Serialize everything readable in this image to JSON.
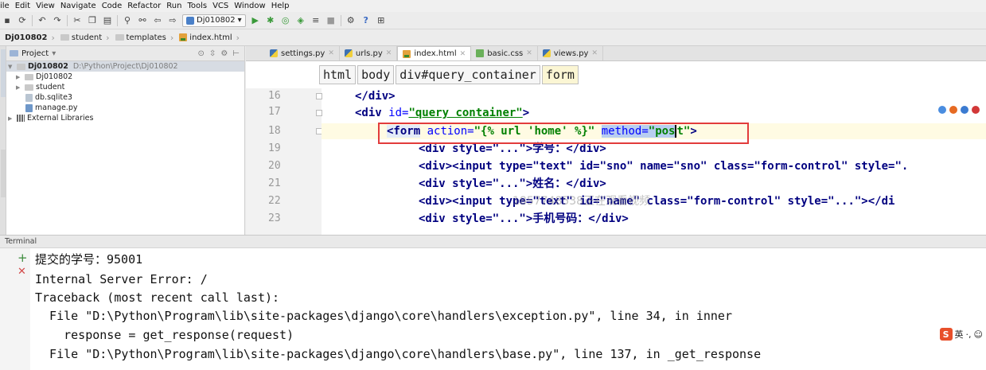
{
  "menu": [
    {
      "label": "ile",
      "u": ""
    },
    {
      "label": "Edit",
      "u": "E"
    },
    {
      "label": "View",
      "u": "V"
    },
    {
      "label": "Navigate",
      "u": "N"
    },
    {
      "label": "Code",
      "u": "C"
    },
    {
      "label": "Refactor",
      "u": "R"
    },
    {
      "label": "Run",
      "u": "u"
    },
    {
      "label": "Tools",
      "u": "T"
    },
    {
      "label": "VCS",
      "u": "S"
    },
    {
      "label": "Window",
      "u": "W"
    },
    {
      "label": "Help",
      "u": "H"
    }
  ],
  "toolbar": {
    "run_config": "Dj010802"
  },
  "breadcrumb": [
    "Dj010802",
    "student",
    "templates",
    "index.html"
  ],
  "project_panel": {
    "title": "Project",
    "root_name": "Dj010802",
    "root_path": "D:\\Python\\Project\\Dj010802",
    "items": [
      "Dj010802",
      "student",
      "db.sqlite3",
      "manage.py",
      "External Libraries"
    ]
  },
  "editor_tabs": [
    {
      "label": "settings.py",
      "type": "py"
    },
    {
      "label": "urls.py",
      "type": "py"
    },
    {
      "label": "index.html",
      "type": "html",
      "active": true
    },
    {
      "label": "basic.css",
      "type": "css"
    },
    {
      "label": "views.py",
      "type": "py"
    }
  ],
  "editor": {
    "path": [
      "html",
      "body",
      "div#query_container",
      "form"
    ],
    "line_numbers": [
      "16",
      "17",
      "18",
      "19",
      "20",
      "21",
      "22",
      "23"
    ],
    "lines": {
      "l16": "</div>",
      "l17_tag": "<div",
      "l17_attr": " id=",
      "l17_str": "\"query container\"",
      "l17_end": ">",
      "l18_tag": "<form",
      "l18_attr": " action=",
      "l18_str": "\"{% url 'home' %}\"",
      "l18_hl1": "method=",
      "l18_hl2": "\"pos",
      "l18_rest": "t\"",
      "l18_end": ">",
      "l19": "<div style=\"...\">学号：</div>",
      "l20": "<div><input type=\"text\" id=\"sno\" name=\"sno\" class=\"form-control\" style=\".",
      "l21": "<div style=\"...\">姓名：</div>",
      "l22": "<div><input type=\"text\" id=\"name\" class=\"form-control\" style=\"...\"></di",
      "l23": "<div style=\"...\">手机号码：</div>"
    },
    "watermark": "1857748538正在观看视频"
  },
  "terminal": {
    "title": "Terminal",
    "lines": [
      "提交的学号：95001",
      "Internal Server Error: /",
      "Traceback (most recent call last):",
      "  File \"D:\\Python\\Program\\lib\\site-packages\\django\\core\\handlers\\exception.py\", line 34, in inner",
      "    response = get_response(request)",
      "  File \"D:\\Python\\Program\\lib\\site-packages\\django\\core\\handlers\\base.py\", line 137, in _get_response"
    ]
  },
  "ime": {
    "label": "英"
  }
}
